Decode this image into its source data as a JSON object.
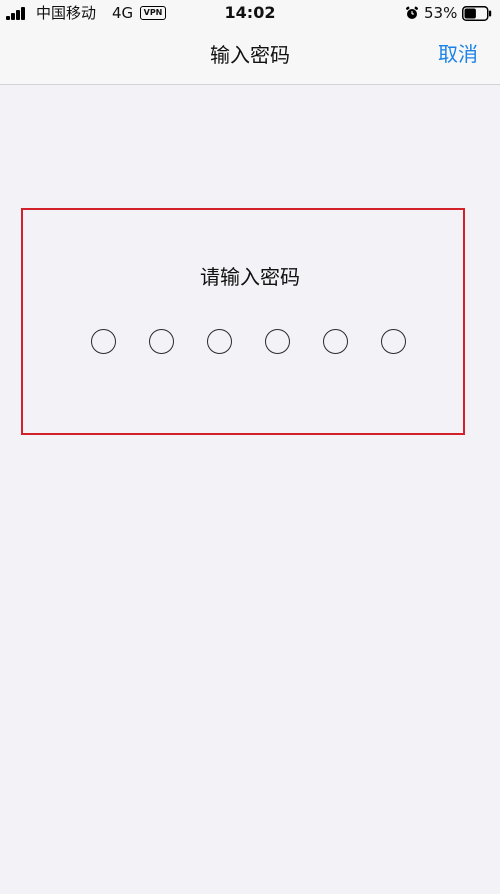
{
  "status_bar": {
    "carrier": "中国移动",
    "network": "4G",
    "vpn": "VPN",
    "time": "14:02",
    "battery": "53%",
    "battery_level": 0.53,
    "icons": [
      "signal-icon",
      "alarm-icon",
      "battery-icon"
    ]
  },
  "nav": {
    "title": "输入密码",
    "cancel_label": "取消"
  },
  "passcode": {
    "prompt": "请输入密码",
    "length": 6,
    "entered": 0
  },
  "colors": {
    "accent": "#1a82e8",
    "highlight": "#d3212b",
    "background": "#f2f2f7",
    "bar": "#f7f7f7"
  }
}
